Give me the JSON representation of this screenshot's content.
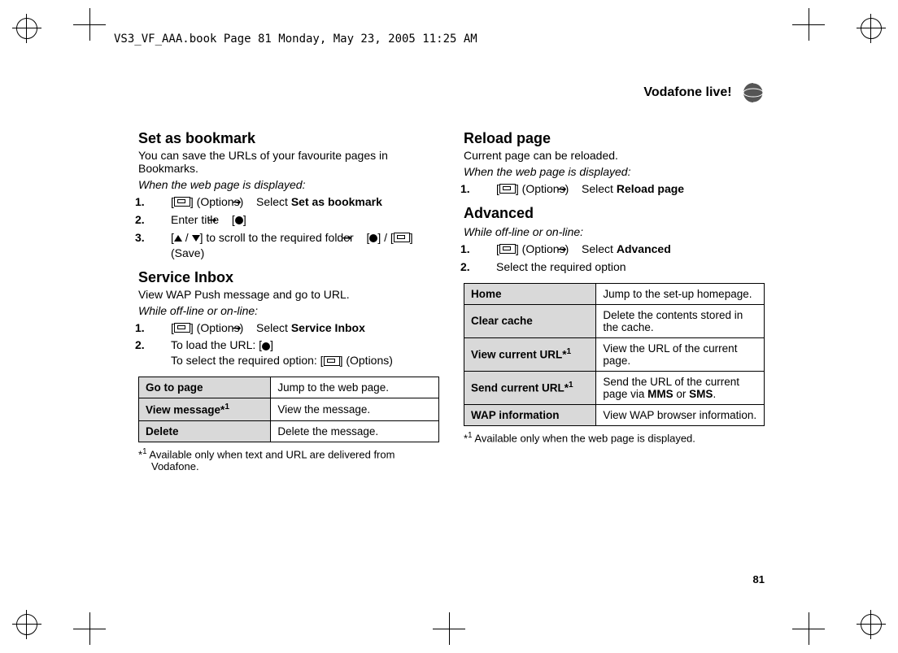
{
  "file_header": "VS3_VF_AAA.book  Page 81  Monday, May 23, 2005  11:25 AM",
  "page_title": "Vodafone live!",
  "page_number": "81",
  "left": {
    "bookmark": {
      "title": "Set as bookmark",
      "desc": "You can save the URLs of your favourite pages in Bookmarks.",
      "when": "When the web page is displayed:",
      "step1_a": "] (Options) ",
      "step1_b": " Select ",
      "step1_bold": "Set as bookmark",
      "step2_a": "Enter title ",
      "step3_a": "] to scroll to the required folder ",
      "step3_save": " (Save)"
    },
    "service": {
      "title": "Service Inbox",
      "desc": "View WAP Push message and go to URL.",
      "when": "While off-line or on-line:",
      "step1_a": "] (Options) ",
      "step1_b": " Select ",
      "step1_bold": "Service Inbox",
      "step2_a": "To load the URL: [",
      "step2_extra": "To select the required option: [",
      "step2_extra_end": "] (Options)",
      "table": {
        "r1a": "Go to page",
        "r1b": "Jump to the web page.",
        "r2a": "View message*",
        "r2b": "View the message.",
        "r3a": "Delete",
        "r3b": "Delete the message."
      },
      "footnote": " Available only when text and URL are delivered from Vodafone."
    }
  },
  "right": {
    "reload": {
      "title": "Reload page",
      "desc": "Current page can be reloaded.",
      "when": "When the web page is displayed:",
      "step1_a": "] (Options) ",
      "step1_b": " Select ",
      "step1_bold": "Reload page"
    },
    "advanced": {
      "title": "Advanced",
      "when": "While off-line or on-line:",
      "step1_a": "] (Options) ",
      "step1_b": " Select ",
      "step1_bold": "Advanced",
      "step2": "Select the required option",
      "table": {
        "r1a": "Home",
        "r1b": "Jump to the set-up homepage.",
        "r2a": "Clear cache",
        "r2b": "Delete the contents stored in the cache.",
        "r3a": "View current URL*",
        "r3b": "View the URL of the current page.",
        "r4a": "Send current URL*",
        "r4b_pre": "Send the URL of the current page via ",
        "r4b_bold1": "MMS",
        "r4b_mid": " or ",
        "r4b_bold2": "SMS",
        "r4b_end": ".",
        "r5a": "WAP information",
        "r5b": "View WAP browser information."
      },
      "footnote": " Available only when the web page is displayed."
    }
  }
}
